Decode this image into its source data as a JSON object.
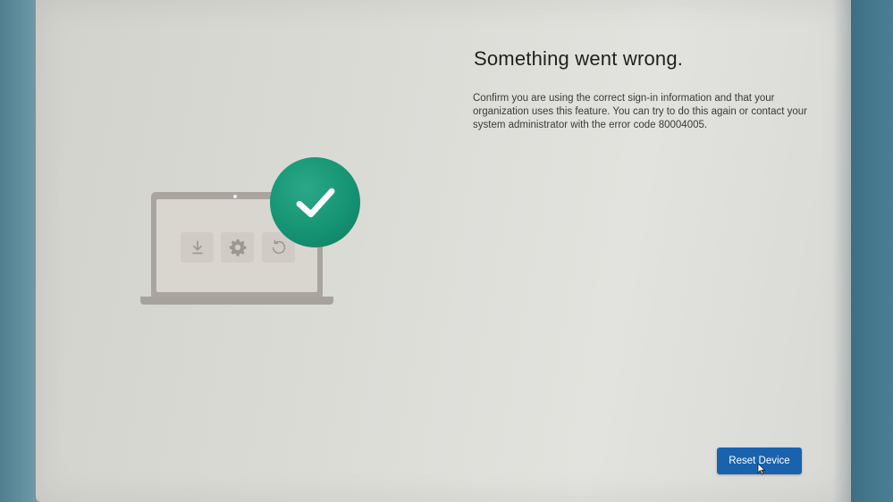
{
  "error_page": {
    "title": "Something went wrong.",
    "message": "Confirm you are using the correct sign-in information and that your organization uses this feature. You can try to do this again or contact your system administrator with the error code 80004005."
  },
  "illustration": {
    "tiles": [
      "download-icon",
      "gear-icon",
      "refresh-icon"
    ],
    "badge_icon": "checkmark-icon",
    "badge_color": "#159474"
  },
  "actions": {
    "reset_label": "Reset Device",
    "reset_color": "#1a62ad"
  }
}
